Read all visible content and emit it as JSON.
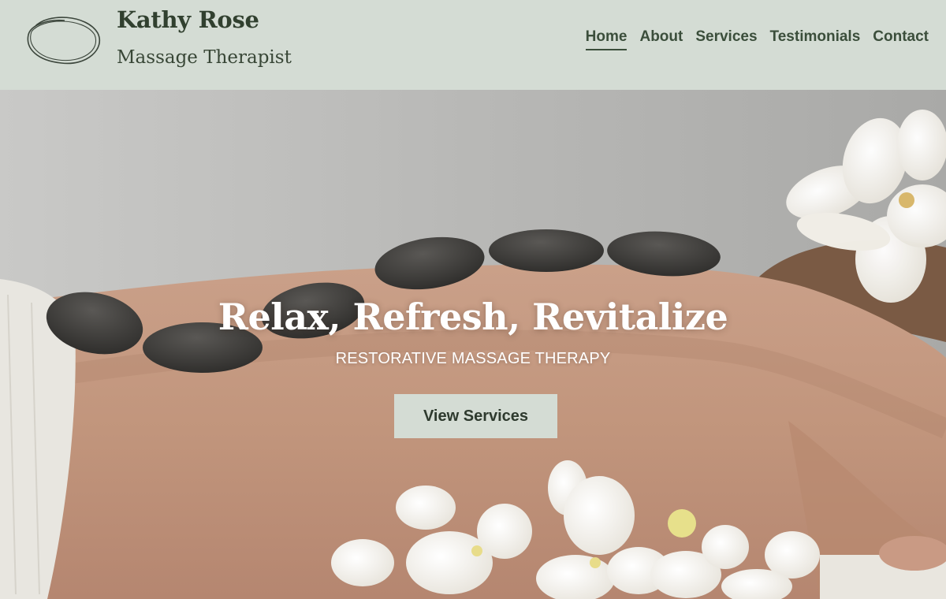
{
  "header": {
    "brand_name": "Kathy Rose",
    "brand_subtitle": "Massage Therapist",
    "logo_icon": "oval-scribble-logo"
  },
  "nav": {
    "items": [
      {
        "label": "Home",
        "active": true
      },
      {
        "label": "About",
        "active": false
      },
      {
        "label": "Services",
        "active": false
      },
      {
        "label": "Testimonials",
        "active": false
      },
      {
        "label": "Contact",
        "active": false
      }
    ]
  },
  "hero": {
    "title": "Relax, Refresh, Revitalize",
    "subtitle": "RESTORATIVE MASSAGE THERAPY",
    "cta_label": "View Services"
  },
  "colors": {
    "header_bg": "#d4dcd4",
    "nav_text": "#3b4e3b",
    "brand_text": "#31402f",
    "button_bg": "#d4dcd4",
    "hero_text": "#ffffff"
  }
}
